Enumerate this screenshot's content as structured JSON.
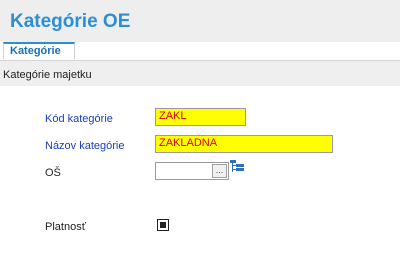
{
  "window": {
    "title": "Kategórie OE"
  },
  "tabs": [
    {
      "label": "Kategórie"
    }
  ],
  "section": {
    "label": "Kategórie majetku"
  },
  "form": {
    "kod": {
      "label": "Kód kategórie",
      "value": "ZAKL"
    },
    "nazov": {
      "label": "Názov kategórie",
      "value": "ZAKLADNA"
    },
    "os": {
      "label": "OŠ",
      "value": "",
      "browse_label": "..."
    },
    "platnost": {
      "label": "Platnosť",
      "checked": true
    }
  },
  "colors": {
    "accent": "#2a8fd4",
    "required_label": "#1a3fb8",
    "highlight_bg": "#ffff00",
    "highlight_text": "#e00000"
  },
  "icons": {
    "tree": "tree-icon",
    "browse": "ellipsis-icon"
  }
}
